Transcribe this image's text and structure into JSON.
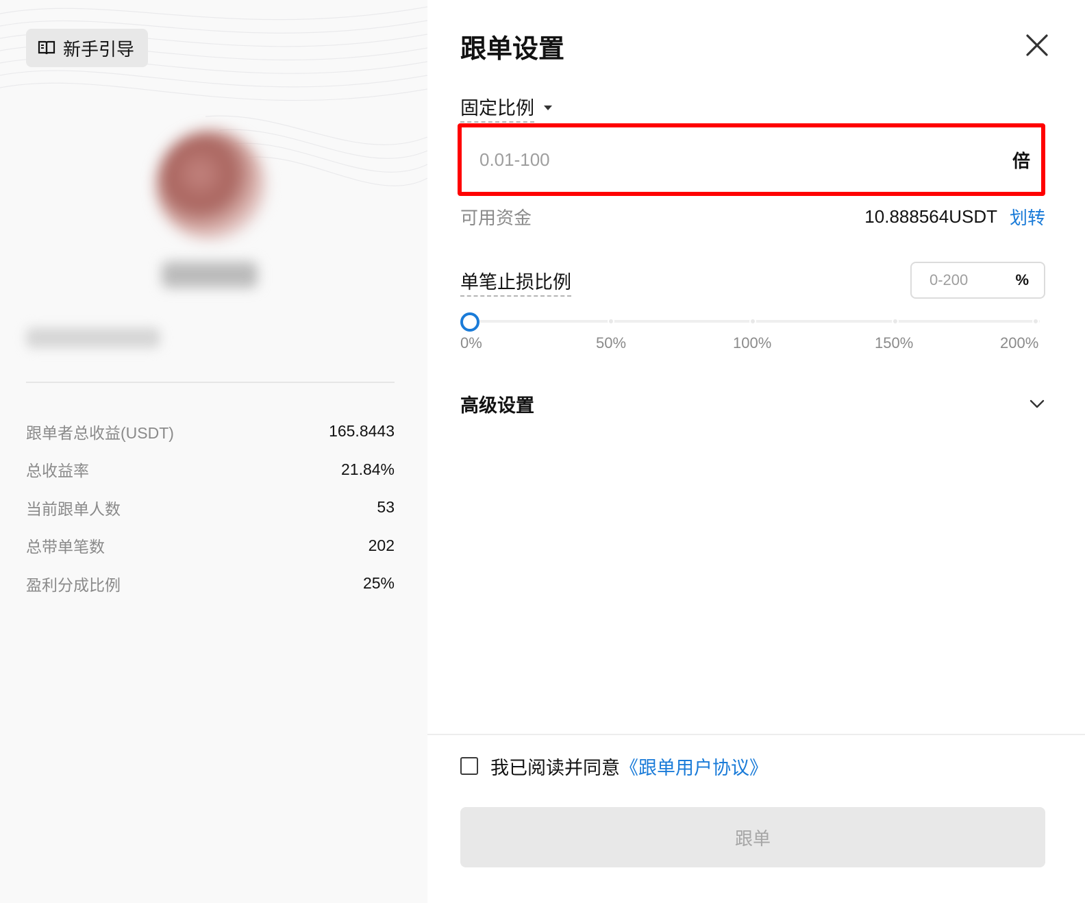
{
  "left_panel": {
    "guide_button_label": "新手引导",
    "stats": [
      {
        "label": "跟单者总收益(USDT)",
        "value": "165.8443"
      },
      {
        "label": "总收益率",
        "value": "21.84%"
      },
      {
        "label": "当前跟单人数",
        "value": "53"
      },
      {
        "label": "总带单笔数",
        "value": "202"
      },
      {
        "label": "盈利分成比例",
        "value": "25%"
      }
    ]
  },
  "dialog": {
    "title": "跟单设置",
    "mode_select": "固定比例",
    "ratio_input": {
      "placeholder": "0.01-100",
      "unit": "倍"
    },
    "funds": {
      "label": "可用资金",
      "amount": "10.888564USDT",
      "transfer_label": "划转"
    },
    "stop_loss": {
      "label": "单笔止损比例",
      "placeholder": "0-200",
      "unit": "%",
      "slider_value_percent": 0,
      "marks": [
        "0%",
        "50%",
        "100%",
        "150%",
        "200%"
      ]
    },
    "advanced_label": "高级设置",
    "agreement": {
      "text": "我已阅读并同意",
      "link": "《跟单用户协议》",
      "checked": false
    },
    "follow_button_label": "跟单"
  },
  "colors": {
    "accent": "#1a7bd8",
    "highlight_border": "#ff0000",
    "disabled_button_bg": "#e8e8e8"
  }
}
